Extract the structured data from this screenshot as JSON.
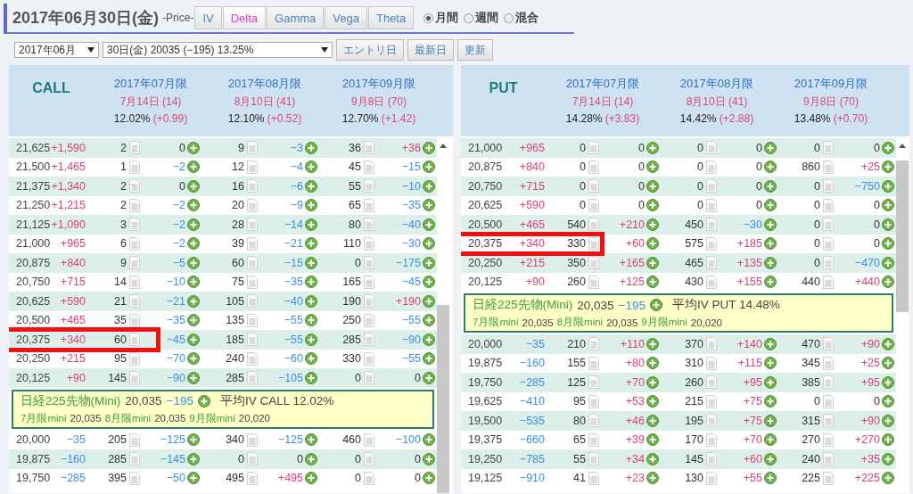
{
  "header": {
    "title": "2017年06月30日(金)",
    "price_label": "-Price-",
    "tabs": [
      {
        "label": "IV",
        "selected": false
      },
      {
        "label": "Delta",
        "selected": true
      },
      {
        "label": "Gamma",
        "selected": false
      },
      {
        "label": "Vega",
        "selected": false
      },
      {
        "label": "Theta",
        "selected": false
      }
    ],
    "periods": [
      {
        "label": "月間",
        "selected": true
      },
      {
        "label": "週間",
        "selected": false
      },
      {
        "label": "混合",
        "selected": false
      }
    ]
  },
  "toolbar": {
    "month_select": "2017年06月",
    "day_select": "30日(金) 20035 (−195) 13.25%",
    "buttons": [
      "エントリ日",
      "最新日",
      "更新"
    ]
  },
  "panels": [
    {
      "label": "CALL",
      "expiries": [
        {
          "month": "2017年07月限",
          "date": "7月14日 (14)",
          "iv": "12.02%",
          "iv_change": "(+0.99)"
        },
        {
          "month": "2017年08月限",
          "date": "8月10日 (41)",
          "iv": "12.10%",
          "iv_change": "(+0.52)"
        },
        {
          "month": "2017年09月限",
          "date": "9月8日 (70)",
          "iv": "12.70%",
          "iv_change": "(+1.42)"
        }
      ],
      "rows": [
        {
          "kind": "strike",
          "strike": "21,625",
          "change": "+1,590",
          "color": "#d93f7e",
          "highlighted": false,
          "cells": [
            {
              "price": "2",
              "delta": "0"
            },
            {
              "price": "9",
              "delta": "−3",
              "color": "#3d8ee8"
            },
            {
              "price": "36",
              "delta": "+36",
              "color": "#d93f7e"
            }
          ]
        },
        {
          "kind": "strike",
          "strike": "21,500",
          "change": "+1,465",
          "color": "#d93f7e",
          "highlighted": false,
          "cells": [
            {
              "price": "1",
              "delta": "−2",
              "color": "#3d8ee8"
            },
            {
              "price": "12",
              "delta": "−4",
              "color": "#3d8ee8"
            },
            {
              "price": "45",
              "delta": "−15",
              "color": "#3d8ee8"
            }
          ]
        },
        {
          "kind": "strike",
          "strike": "21,375",
          "change": "+1,340",
          "color": "#d93f7e",
          "highlighted": false,
          "cells": [
            {
              "price": "2",
              "delta": "0"
            },
            {
              "price": "16",
              "delta": "−6",
              "color": "#3d8ee8"
            },
            {
              "price": "55",
              "delta": "−10",
              "color": "#3d8ee8"
            }
          ]
        },
        {
          "kind": "strike",
          "strike": "21,250",
          "change": "+1,215",
          "color": "#d93f7e",
          "highlighted": false,
          "cells": [
            {
              "price": "2",
              "delta": "−2",
              "color": "#3d8ee8"
            },
            {
              "price": "20",
              "delta": "−9",
              "color": "#3d8ee8"
            },
            {
              "price": "65",
              "delta": "−35",
              "color": "#3d8ee8"
            }
          ]
        },
        {
          "kind": "strike",
          "strike": "21,125",
          "change": "+1,090",
          "color": "#d93f7e",
          "highlighted": false,
          "cells": [
            {
              "price": "3",
              "delta": "−2",
              "color": "#3d8ee8"
            },
            {
              "price": "28",
              "delta": "−14",
              "color": "#3d8ee8"
            },
            {
              "price": "80",
              "delta": "−40",
              "color": "#3d8ee8"
            }
          ]
        },
        {
          "kind": "strike",
          "strike": "21,000",
          "change": "+965",
          "color": "#d93f7e",
          "highlighted": false,
          "cells": [
            {
              "price": "6",
              "delta": "−2",
              "color": "#3d8ee8"
            },
            {
              "price": "39",
              "delta": "−21",
              "color": "#3d8ee8"
            },
            {
              "price": "110",
              "delta": "−30",
              "color": "#3d8ee8"
            }
          ]
        },
        {
          "kind": "strike",
          "strike": "20,875",
          "change": "+840",
          "color": "#d93f7e",
          "highlighted": false,
          "cells": [
            {
              "price": "9",
              "delta": "−5",
              "color": "#3d8ee8"
            },
            {
              "price": "60",
              "delta": "−15",
              "color": "#3d8ee8"
            },
            {
              "price": "0",
              "delta": "−175",
              "color": "#3d8ee8"
            }
          ]
        },
        {
          "kind": "strike",
          "strike": "20,750",
          "change": "+715",
          "color": "#d93f7e",
          "highlighted": false,
          "cells": [
            {
              "price": "14",
              "delta": "−10",
              "color": "#3d8ee8"
            },
            {
              "price": "75",
              "delta": "−35",
              "color": "#3d8ee8"
            },
            {
              "price": "165",
              "delta": "−45",
              "color": "#3d8ee8"
            }
          ]
        },
        {
          "kind": "strike",
          "strike": "20,625",
          "change": "+590",
          "color": "#d93f7e",
          "highlighted": false,
          "cells": [
            {
              "price": "21",
              "delta": "−21",
              "color": "#3d8ee8"
            },
            {
              "price": "105",
              "delta": "−40",
              "color": "#3d8ee8"
            },
            {
              "price": "190",
              "delta": "+190",
              "color": "#d93f7e"
            }
          ]
        },
        {
          "kind": "strike",
          "strike": "20,500",
          "change": "+465",
          "color": "#d93f7e",
          "highlighted": false,
          "cells": [
            {
              "price": "35",
              "delta": "−35",
              "color": "#3d8ee8"
            },
            {
              "price": "135",
              "delta": "−55",
              "color": "#3d8ee8"
            },
            {
              "price": "250",
              "delta": "−55",
              "color": "#3d8ee8"
            }
          ]
        },
        {
          "kind": "strike",
          "strike": "20,375",
          "change": "+340",
          "color": "#d93f7e",
          "highlighted": true,
          "cells": [
            {
              "price": "60",
              "delta": "−45",
              "color": "#3d8ee8"
            },
            {
              "price": "185",
              "delta": "−55",
              "color": "#3d8ee8"
            },
            {
              "price": "285",
              "delta": "−90",
              "color": "#3d8ee8"
            }
          ]
        },
        {
          "kind": "strike",
          "strike": "20,250",
          "change": "+215",
          "color": "#d93f7e",
          "highlighted": false,
          "cells": [
            {
              "price": "95",
              "delta": "−70",
              "color": "#3d8ee8"
            },
            {
              "price": "240",
              "delta": "−60",
              "color": "#3d8ee8"
            },
            {
              "price": "330",
              "delta": "−55",
              "color": "#3d8ee8"
            }
          ]
        },
        {
          "kind": "strike",
          "strike": "20,125",
          "change": "+90",
          "color": "#d93f7e",
          "highlighted": false,
          "cells": [
            {
              "price": "145",
              "delta": "−90",
              "color": "#3d8ee8"
            },
            {
              "price": "285",
              "delta": "−105",
              "color": "#3d8ee8"
            },
            {
              "price": "0",
              "delta": "0"
            }
          ]
        },
        {
          "kind": "futures",
          "name": "日経225先物(Mini)",
          "price": "20,035",
          "change": "−195",
          "avg_iv": "平均IV CALL 12.02%",
          "minis": [
            {
              "label": "7月限mini",
              "price": "20,035"
            },
            {
              "label": "8月限mini",
              "price": "20,035"
            },
            {
              "label": "9月限mini",
              "price": "20,020"
            }
          ]
        },
        {
          "kind": "strike",
          "strike": "20,000",
          "change": "−35",
          "color": "#3d8ee8",
          "highlighted": false,
          "cells": [
            {
              "price": "205",
              "delta": "−125",
              "color": "#3d8ee8"
            },
            {
              "price": "340",
              "delta": "−125",
              "color": "#3d8ee8"
            },
            {
              "price": "460",
              "delta": "−100",
              "color": "#3d8ee8"
            }
          ]
        },
        {
          "kind": "strike",
          "strike": "19,875",
          "change": "−160",
          "color": "#3d8ee8",
          "highlighted": false,
          "cells": [
            {
              "price": "285",
              "delta": "−145",
              "color": "#3d8ee8"
            },
            {
              "price": "0",
              "delta": "0"
            },
            {
              "price": "0",
              "delta": "0"
            }
          ]
        },
        {
          "kind": "strike",
          "strike": "19,750",
          "change": "−285",
          "color": "#3d8ee8",
          "highlighted": false,
          "cells": [
            {
              "price": "395",
              "delta": "−50",
              "color": "#3d8ee8"
            },
            {
              "price": "495",
              "delta": "+495",
              "color": "#d93f7e"
            },
            {
              "price": "0",
              "delta": "0"
            }
          ]
        }
      ]
    },
    {
      "label": "PUT",
      "expiries": [
        {
          "month": "2017年07月限",
          "date": "7月14日 (14)",
          "iv": "14.28%",
          "iv_change": "(+3.83)"
        },
        {
          "month": "2017年08月限",
          "date": "8月10日 (41)",
          "iv": "14.42%",
          "iv_change": "(+2.88)"
        },
        {
          "month": "2017年09月限",
          "date": "9月8日 (70)",
          "iv": "13.48%",
          "iv_change": "(+0.70)"
        }
      ],
      "rows": [
        {
          "kind": "strike",
          "strike": "21,000",
          "change": "+965",
          "color": "#d93f7e",
          "highlighted": false,
          "cells": [
            {
              "price": "0",
              "delta": "0"
            },
            {
              "price": "0",
              "delta": "0"
            },
            {
              "price": "0",
              "delta": "0"
            }
          ]
        },
        {
          "kind": "strike",
          "strike": "20,875",
          "change": "+840",
          "color": "#d93f7e",
          "highlighted": false,
          "cells": [
            {
              "price": "0",
              "delta": "0"
            },
            {
              "price": "0",
              "delta": "0"
            },
            {
              "price": "860",
              "delta": "+25",
              "color": "#d93f7e"
            }
          ]
        },
        {
          "kind": "strike",
          "strike": "20,750",
          "change": "+715",
          "color": "#d93f7e",
          "highlighted": false,
          "cells": [
            {
              "price": "0",
              "delta": "0"
            },
            {
              "price": "0",
              "delta": "0"
            },
            {
              "price": "0",
              "delta": "−750",
              "color": "#3d8ee8"
            }
          ]
        },
        {
          "kind": "strike",
          "strike": "20,625",
          "change": "+590",
          "color": "#d93f7e",
          "highlighted": false,
          "cells": [
            {
              "price": "0",
              "delta": "0"
            },
            {
              "price": "0",
              "delta": "0"
            },
            {
              "price": "0",
              "delta": "0"
            }
          ]
        },
        {
          "kind": "strike",
          "strike": "20,500",
          "change": "+465",
          "color": "#d93f7e",
          "highlighted": false,
          "cells": [
            {
              "price": "540",
              "delta": "+210",
              "color": "#d93f7e"
            },
            {
              "price": "450",
              "delta": "−30",
              "color": "#3d8ee8"
            },
            {
              "price": "0",
              "delta": "0"
            }
          ]
        },
        {
          "kind": "strike",
          "strike": "20,375",
          "change": "+340",
          "color": "#d93f7e",
          "highlighted": true,
          "cells": [
            {
              "price": "330",
              "delta": "+60",
              "color": "#d93f7e"
            },
            {
              "price": "575",
              "delta": "+185",
              "color": "#d93f7e"
            },
            {
              "price": "0",
              "delta": "0"
            }
          ]
        },
        {
          "kind": "strike",
          "strike": "20,250",
          "change": "+215",
          "color": "#d93f7e",
          "highlighted": false,
          "cells": [
            {
              "price": "350",
              "delta": "+165",
              "color": "#d93f7e"
            },
            {
              "price": "465",
              "delta": "+135",
              "color": "#d93f7e"
            },
            {
              "price": "0",
              "delta": "−470",
              "color": "#3d8ee8"
            }
          ]
        },
        {
          "kind": "strike",
          "strike": "20,125",
          "change": "+90",
          "color": "#d93f7e",
          "highlighted": false,
          "cells": [
            {
              "price": "260",
              "delta": "+125",
              "color": "#d93f7e"
            },
            {
              "price": "430",
              "delta": "+155",
              "color": "#d93f7e"
            },
            {
              "price": "440",
              "delta": "+440",
              "color": "#d93f7e"
            }
          ]
        },
        {
          "kind": "futures",
          "name": "日経225先物(Mini)",
          "price": "20,035",
          "change": "−195",
          "avg_iv": "平均IV PUT 14.48%",
          "minis": [
            {
              "label": "7月限mini",
              "price": "20,035"
            },
            {
              "label": "8月限mini",
              "price": "20,035"
            },
            {
              "label": "9月限mini",
              "price": "20,020"
            }
          ]
        },
        {
          "kind": "strike",
          "strike": "20,000",
          "change": "−35",
          "color": "#3d8ee8",
          "highlighted": false,
          "cells": [
            {
              "price": "210",
              "delta": "+110",
              "color": "#d93f7e"
            },
            {
              "price": "370",
              "delta": "+140",
              "color": "#d93f7e"
            },
            {
              "price": "470",
              "delta": "+90",
              "color": "#d93f7e"
            }
          ]
        },
        {
          "kind": "strike",
          "strike": "19,875",
          "change": "−160",
          "color": "#3d8ee8",
          "highlighted": false,
          "cells": [
            {
              "price": "155",
              "delta": "+80",
              "color": "#d93f7e"
            },
            {
              "price": "310",
              "delta": "+115",
              "color": "#d93f7e"
            },
            {
              "price": "345",
              "delta": "+25",
              "color": "#d93f7e"
            }
          ]
        },
        {
          "kind": "strike",
          "strike": "19,750",
          "change": "−285",
          "color": "#3d8ee8",
          "highlighted": false,
          "cells": [
            {
              "price": "125",
              "delta": "+70",
              "color": "#d93f7e"
            },
            {
              "price": "260",
              "delta": "+95",
              "color": "#d93f7e"
            },
            {
              "price": "385",
              "delta": "+95",
              "color": "#d93f7e"
            }
          ]
        },
        {
          "kind": "strike",
          "strike": "19,625",
          "change": "−410",
          "color": "#3d8ee8",
          "highlighted": false,
          "cells": [
            {
              "price": "95",
              "delta": "+53",
              "color": "#d93f7e"
            },
            {
              "price": "215",
              "delta": "+75",
              "color": "#d93f7e"
            },
            {
              "price": "0",
              "delta": "0"
            }
          ]
        },
        {
          "kind": "strike",
          "strike": "19,500",
          "change": "−535",
          "color": "#3d8ee8",
          "highlighted": false,
          "cells": [
            {
              "price": "80",
              "delta": "+46",
              "color": "#d93f7e"
            },
            {
              "price": "195",
              "delta": "+75",
              "color": "#d93f7e"
            },
            {
              "price": "315",
              "delta": "+90",
              "color": "#d93f7e"
            }
          ]
        },
        {
          "kind": "strike",
          "strike": "19,375",
          "change": "−660",
          "color": "#3d8ee8",
          "highlighted": false,
          "cells": [
            {
              "price": "65",
              "delta": "+39",
              "color": "#d93f7e"
            },
            {
              "price": "170",
              "delta": "+70",
              "color": "#d93f7e"
            },
            {
              "price": "270",
              "delta": "+270",
              "color": "#d93f7e"
            }
          ]
        },
        {
          "kind": "strike",
          "strike": "19,250",
          "change": "−785",
          "color": "#3d8ee8",
          "highlighted": false,
          "cells": [
            {
              "price": "55",
              "delta": "+34",
              "color": "#d93f7e"
            },
            {
              "price": "145",
              "delta": "+60",
              "color": "#d93f7e"
            },
            {
              "price": "240",
              "delta": "+35",
              "color": "#d93f7e"
            }
          ]
        },
        {
          "kind": "strike",
          "strike": "19,125",
          "change": "−910",
          "color": "#3d8ee8",
          "highlighted": false,
          "cells": [
            {
              "price": "41",
              "delta": "+23",
              "color": "#d93f7e"
            },
            {
              "price": "130",
              "delta": "+55",
              "color": "#d93f7e"
            },
            {
              "price": "225",
              "delta": "+225",
              "color": "#d93f7e"
            }
          ]
        }
      ]
    }
  ]
}
